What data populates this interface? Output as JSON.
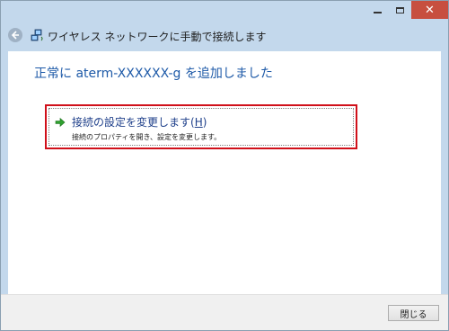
{
  "window": {
    "minimize_icon": "minimize-icon",
    "maximize_icon": "maximize-icon",
    "close_icon": "close-icon",
    "close_color": "#c74f3f"
  },
  "nav": {
    "back_icon": "back-arrow-icon",
    "network_icon": "wireless-network-icon",
    "title": "ワイヤレス ネットワークに手動で接続します"
  },
  "main": {
    "heading": "正常に aterm-XXXXXX-g を追加しました",
    "action": {
      "icon": "green-arrow-icon",
      "title": "接続の設定を変更します(",
      "access_key": "H",
      "title_end": ")",
      "description": "接続のプロパティを開き、設定を変更します。",
      "highlight_color": "#d0101a"
    }
  },
  "footer": {
    "close_label_main": "閉じる",
    "close_label_key": ""
  }
}
